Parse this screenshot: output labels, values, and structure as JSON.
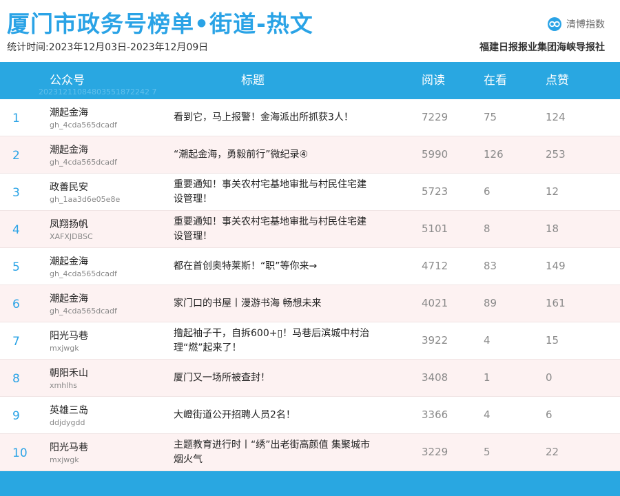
{
  "header": {
    "title": "厦门市政务号榜单•街道-热文",
    "stat_period": "统计时间:2023年12月03日-2023年12月09日",
    "brand_name": "清博指数",
    "publisher": "福建日报报业集团海峡导报社"
  },
  "table": {
    "columns": {
      "account": "公众号",
      "title": "标题",
      "read": "阅读",
      "watching": "在看",
      "likes": "点赞"
    },
    "watermark": "20231211084803551872242 7",
    "rows": [
      {
        "rank": "1",
        "account": "潮起金海",
        "account_id": "gh_4cda565dcadf",
        "title": "看到它，马上报警！金海派出所抓获3人！",
        "read": "7229",
        "watching": "75",
        "likes": "124"
      },
      {
        "rank": "2",
        "account": "潮起金海",
        "account_id": "gh_4cda565dcadf",
        "title": "“潮起金海，勇毅前行”微纪录④",
        "read": "5990",
        "watching": "126",
        "likes": "253"
      },
      {
        "rank": "3",
        "account": "政善民安",
        "account_id": "gh_1aa3d6e05e8e",
        "title": "重要通知！事关农村宅基地审批与村民住宅建设管理！",
        "read": "5723",
        "watching": "6",
        "likes": "12"
      },
      {
        "rank": "4",
        "account": "凤翔扬帆",
        "account_id": "XAFXJDBSC",
        "title": "重要通知！事关农村宅基地审批与村民住宅建设管理！",
        "read": "5101",
        "watching": "8",
        "likes": "18"
      },
      {
        "rank": "5",
        "account": "潮起金海",
        "account_id": "gh_4cda565dcadf",
        "title": "都在首创奥特莱斯！“职”等你来→",
        "read": "4712",
        "watching": "83",
        "likes": "149"
      },
      {
        "rank": "6",
        "account": "潮起金海",
        "account_id": "gh_4cda565dcadf",
        "title": "家门口的书屋丨漫游书海 畅想未来",
        "read": "4021",
        "watching": "89",
        "likes": "161"
      },
      {
        "rank": "7",
        "account": "阳光马巷",
        "account_id": "mxjwgk",
        "title": "撸起袖子干，自拆600+▯！马巷后滨城中村治理“燃”起来了！",
        "read": "3922",
        "watching": "4",
        "likes": "15"
      },
      {
        "rank": "8",
        "account": "朝阳禾山",
        "account_id": "xmhlhs",
        "title": "厦门又一场所被查封！",
        "read": "3408",
        "watching": "1",
        "likes": "0"
      },
      {
        "rank": "9",
        "account": "英雄三岛",
        "account_id": "ddjdygdd",
        "title": "大嶝街道公开招聘人员2名！",
        "read": "3366",
        "watching": "4",
        "likes": "6"
      },
      {
        "rank": "10",
        "account": "阳光马巷",
        "account_id": "mxjwgk",
        "title": "主题教育进行时丨“绣”出老街高颜值 集聚城市烟火气",
        "read": "3229",
        "watching": "5",
        "likes": "22"
      }
    ]
  },
  "colors": {
    "accent": "#29a7e1",
    "title": "#2aa3e6",
    "row_alt": "#fdf2f2"
  },
  "icons": {
    "brand": "qingbo-logo-icon"
  }
}
